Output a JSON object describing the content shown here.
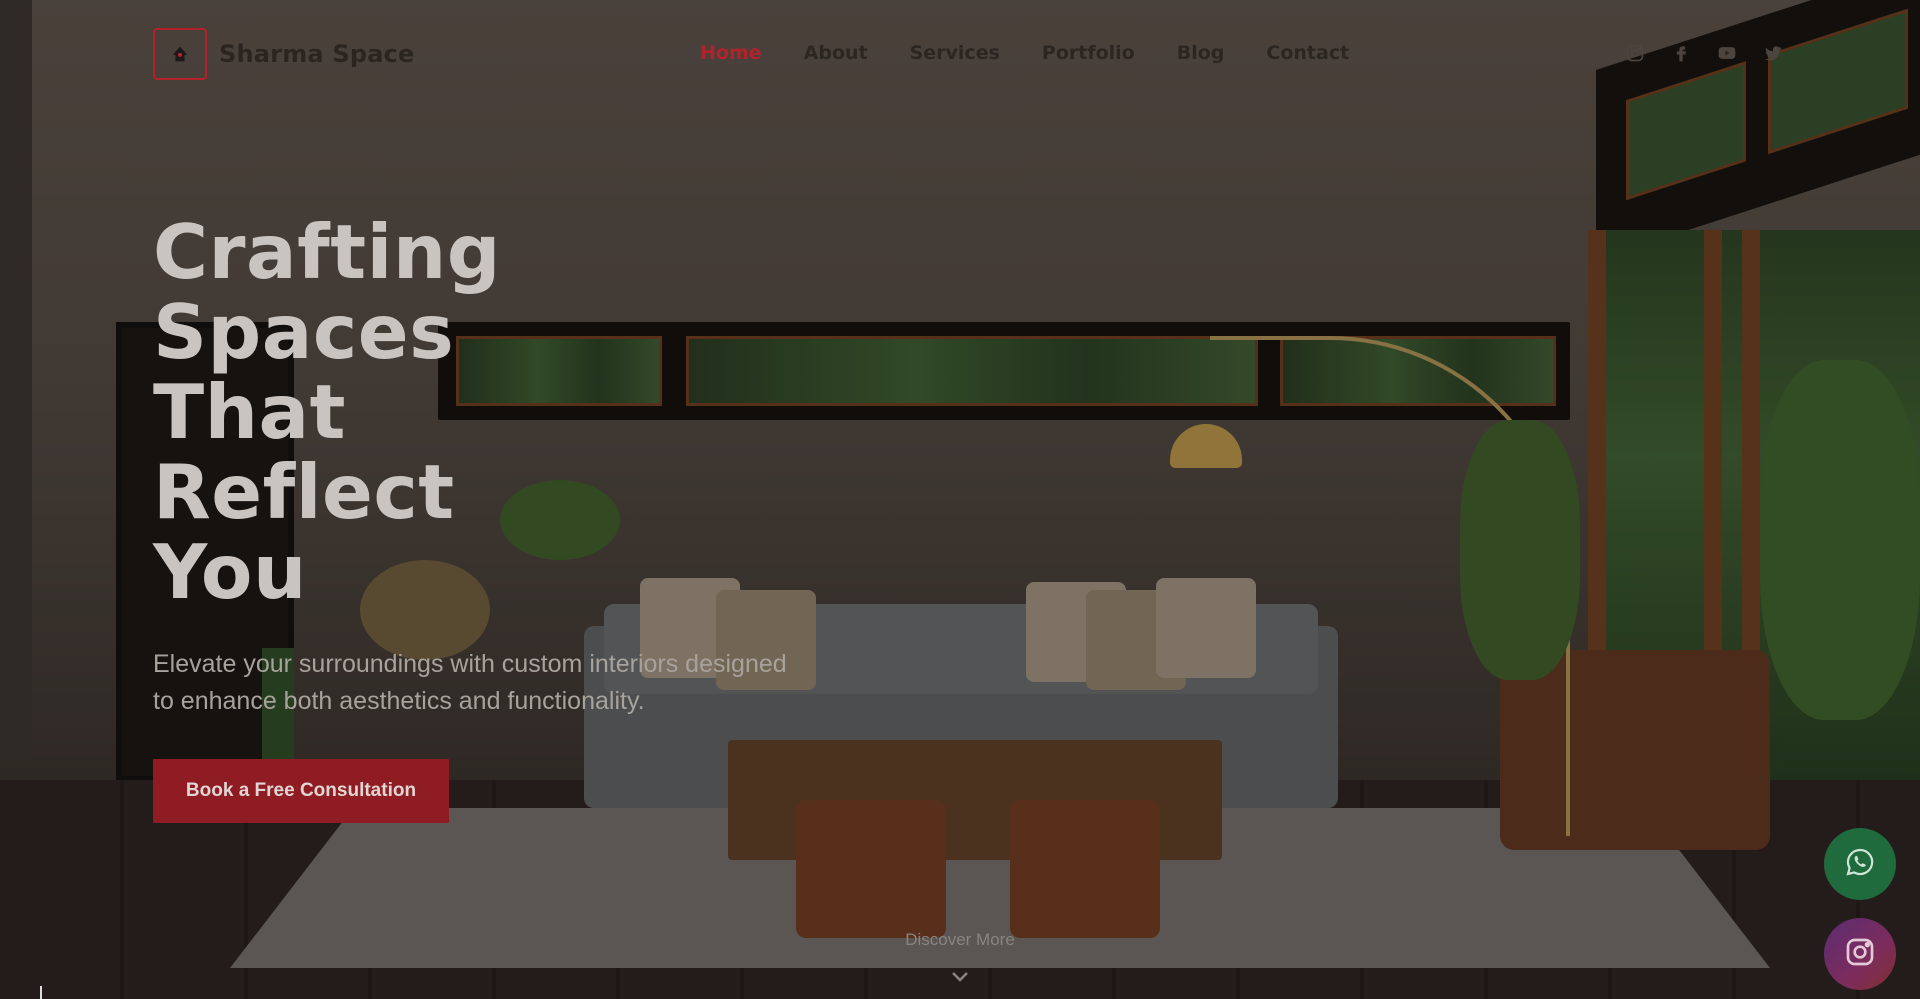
{
  "brand": {
    "name": "Sharma Space",
    "logo_icon": "house-pin-icon",
    "accent_color": "#b3222b"
  },
  "nav": {
    "items": [
      {
        "label": "Home",
        "active": true
      },
      {
        "label": "About",
        "active": false
      },
      {
        "label": "Services",
        "active": false
      },
      {
        "label": "Portfolio",
        "active": false
      },
      {
        "label": "Blog",
        "active": false
      },
      {
        "label": "Contact",
        "active": false
      }
    ]
  },
  "socials": [
    "instagram-icon",
    "facebook-icon",
    "youtube-icon",
    "twitter-icon"
  ],
  "hero": {
    "title_lines": [
      "Crafting",
      "Spaces",
      "That",
      "Reflect",
      "You"
    ],
    "subtitle_line1": "Elevate your surroundings with custom interiors designed",
    "subtitle_line2": "to enhance both aesthetics and functionality.",
    "cta_label": "Book a Free Consultation",
    "cta_color": "#8f1c22"
  },
  "scroll_hint": {
    "label": "Discover More",
    "icon": "chevron-down-icon"
  },
  "floating": {
    "whatsapp_icon": "whatsapp-icon",
    "whatsapp_color": "#1f6b3d",
    "instagram_icon": "instagram-icon"
  }
}
